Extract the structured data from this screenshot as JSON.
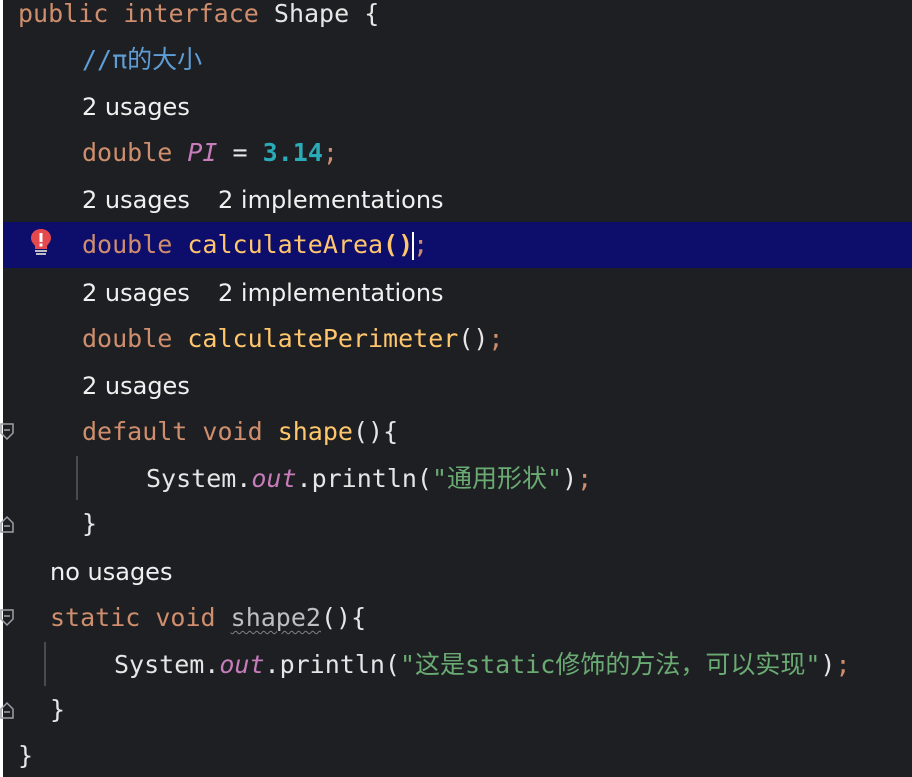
{
  "code": {
    "line1": {
      "kw_public": "public",
      "kw_interface": "interface",
      "name": "Shape",
      "brace": "{"
    },
    "comment": "//π的大小",
    "hint_pi": "2 usages",
    "line_pi": {
      "type": "double",
      "name": "PI",
      "eq": "=",
      "value": "3.14",
      "semi": ";"
    },
    "hint_area": "2 usages",
    "hint_area_impl": "2 implementations",
    "line_area": {
      "type": "double",
      "name": "calculateArea",
      "open": "(",
      "close": ")",
      "semi": ";"
    },
    "hint_perim": "2 usages",
    "hint_perim_impl": "2 implementations",
    "line_perim": {
      "type": "double",
      "name": "calculatePerimeter",
      "parens": "()",
      "semi": ";"
    },
    "hint_shape": "2 usages",
    "line_shape": {
      "kw_default": "default",
      "kw_void": "void",
      "name": "shape",
      "tail": "(){"
    },
    "line_print1": {
      "obj": "System.",
      "field": "out",
      "method": ".println(",
      "str": "\"通用形状\"",
      "close": ")",
      "semi": ";"
    },
    "close_shape": "}",
    "hint_shape2": "no usages",
    "line_shape2": {
      "kw_static": "static",
      "kw_void": "void",
      "name": "shape2",
      "tail": "(){"
    },
    "line_print2": {
      "obj": "System.",
      "field": "out",
      "method": ".println(",
      "str": "\"这是static修饰的方法，可以实现\"",
      "close": ")",
      "semi": ";"
    },
    "close_shape2": "}",
    "close_interface": "}"
  },
  "icons": {
    "bulb": "error-lightbulb-icon",
    "fold": "fold-marker-icon"
  },
  "colors": {
    "background": "#1e1f22",
    "keyword": "#cf8e6d",
    "number": "#2aacb8",
    "string": "#6aab73",
    "field": "#c77dbb",
    "method": "#56a8f5",
    "current_line": "#0d0d6b"
  }
}
